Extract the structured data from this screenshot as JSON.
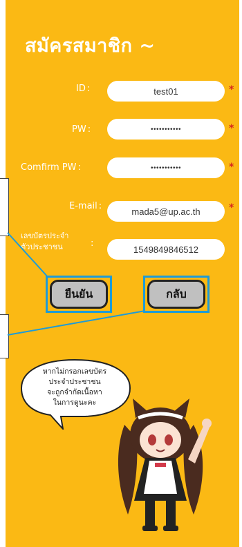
{
  "form": {
    "title": "สมัครสมาชิก ~",
    "id_label": "ID",
    "id_value": "test01",
    "pw_label": "PW",
    "pw_value": "•••••••••••",
    "confirm_label": "Comfirm PW",
    "confirm_value": "•••••••••••",
    "email_label": "E-mail",
    "email_value": "mada5@up.ac.th",
    "citizen_label_line1": "เลขบัตรประจำ",
    "citizen_label_line2": "ตัวประชาชน",
    "citizen_value": "1549849846512",
    "colon": ":",
    "required_mark": "*"
  },
  "buttons": {
    "confirm_label": "ยืนยัน",
    "back_label": "กลับ"
  },
  "speech": {
    "line1": "หากไม่กรอกเลขบัตร",
    "line2": "ประจำประชาชน",
    "line3": "จะถูกจำกัดเนื้อหา",
    "line4": "ในการดูนะคะ"
  },
  "colors": {
    "background": "#fbb914",
    "highlight": "#1e9bd7",
    "required": "#d8281c"
  }
}
